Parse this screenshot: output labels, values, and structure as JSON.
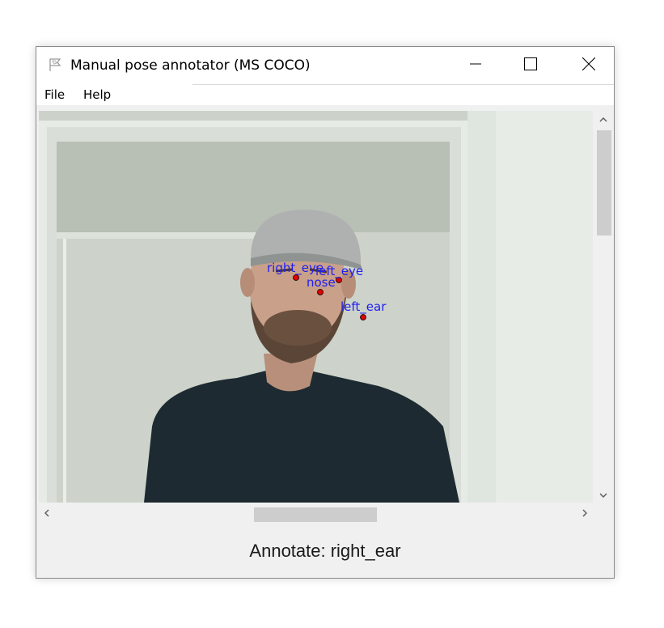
{
  "window": {
    "title": "Manual pose annotator (MS COCO)",
    "minimize_icon": "minimize-icon",
    "maximize_icon": "maximize-icon",
    "close_icon": "close-icon"
  },
  "menu": {
    "items": [
      {
        "label": "File"
      },
      {
        "label": "Help"
      }
    ]
  },
  "canvas": {
    "keypoints": [
      {
        "label": "right_eye"
      },
      {
        "label": "left_eye"
      },
      {
        "label": "nose"
      },
      {
        "label": "left_ear"
      }
    ],
    "keypoint_color": "#e00000",
    "label_color": "#1e1ef5"
  },
  "status": {
    "text": "Annotate: right_ear"
  }
}
